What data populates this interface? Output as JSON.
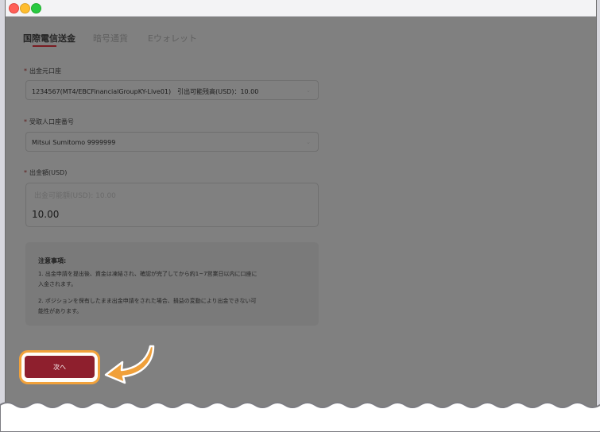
{
  "tabs": [
    {
      "label": "国際電信送金",
      "active": true
    },
    {
      "label": "暗号通貨",
      "active": false
    },
    {
      "label": "Eウォレット",
      "active": false
    }
  ],
  "form": {
    "source_account": {
      "required_mark": "*",
      "label": "出金元口座",
      "value": "1234567(MT4/EBCFinancialGroupKY-Live01)　引出可能残高(USD)：10.00"
    },
    "recipient_account": {
      "required_mark": "*",
      "label": "受取人口座番号",
      "value": "Mitsui Sumitomo 9999999"
    },
    "amount": {
      "required_mark": "*",
      "label": "出金額(USD)",
      "placeholder": "出金可能額(USD): 10.00",
      "value": "10.00"
    }
  },
  "notice": {
    "title": "注意事項:",
    "lines": [
      "1. 出金申請を提出後、資金は凍結され、確認が完了してから約1~7営業日以内に口座に",
      "入金されます。",
      "2. ポジションを保有したまま出金申請をされた場合、損益の変動により出金できない可",
      "能性があります。"
    ]
  },
  "next_button": {
    "label": "次へ"
  },
  "colors": {
    "accent": "#8e1f2d",
    "highlight": "#f2a23b",
    "overlay": "#808080"
  },
  "icons": {
    "dropdown": "chevron-down",
    "pointer": "curved-arrow-left"
  }
}
